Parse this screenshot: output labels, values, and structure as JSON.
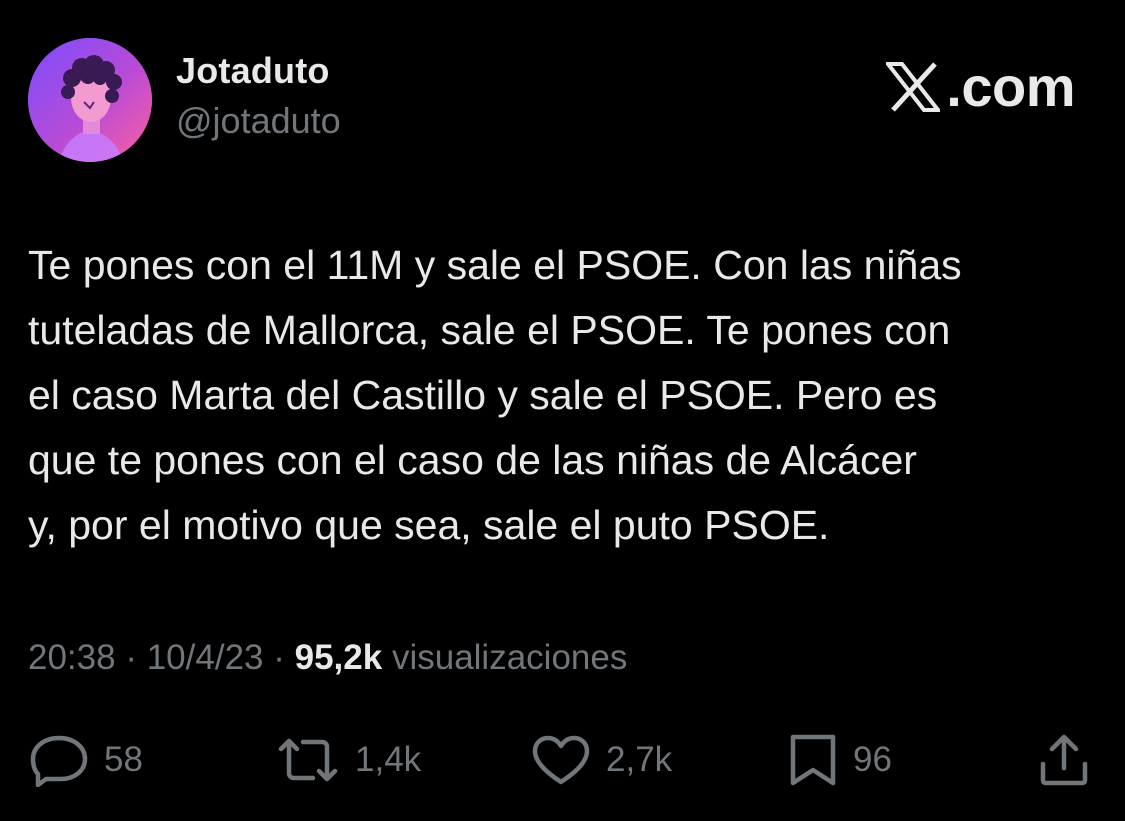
{
  "author": {
    "display_name": "Jotaduto",
    "handle": "@jotaduto"
  },
  "brand": {
    "icon": "x-logo-icon",
    "text": ".com"
  },
  "tweet": {
    "text": "Te pones con el 11M y sale el PSOE. Con las niñas\ntuteladas de Mallorca, sale el PSOE. Te pones con\nel caso Marta del Castillo y sale el PSOE. Pero es\nque te pones con el caso de las niñas de Alcácer\ny, por el motivo que sea, sale el puto PSOE.",
    "time": "20:38",
    "separator": "·",
    "date": "10/4/23",
    "views_count": "95,2k",
    "views_label": "visualizaciones"
  },
  "actions": {
    "replies": {
      "icon": "reply-icon",
      "count": "58"
    },
    "reposts": {
      "icon": "repost-icon",
      "count": "1,4k"
    },
    "likes": {
      "icon": "heart-icon",
      "count": "2,7k"
    },
    "bookmarks": {
      "icon": "bookmark-icon",
      "count": "96"
    },
    "share": {
      "icon": "share-icon"
    }
  },
  "colors": {
    "background": "#000000",
    "primary_text": "#e7e9ea",
    "secondary_text": "#71767b"
  }
}
